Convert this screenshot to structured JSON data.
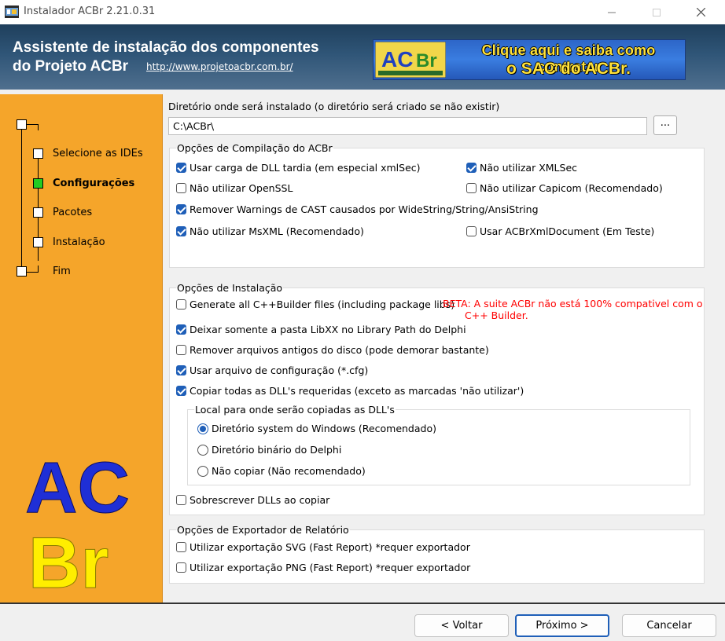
{
  "window": {
    "title": "Instalador ACBr 2.21.0.31"
  },
  "header": {
    "title_line1": "Assistente de instalação dos componentes",
    "title_line2": "do Projeto ACBr",
    "link": "http://www.projetoacbr.com.br/",
    "banner_line1": "Clique aqui e saiba como contratar",
    "banner_line2": "o SAC do ACBr.",
    "banner_logo_text": "ACBr",
    "banner_logo_sub": "Automação Comercial Brasil"
  },
  "sidebar": {
    "steps": [
      {
        "label": "Selecione as IDEs",
        "active": false
      },
      {
        "label": "Configurações",
        "active": true
      },
      {
        "label": "Pacotes",
        "active": false
      },
      {
        "label": "Instalação",
        "active": false
      },
      {
        "label": "Fim",
        "active": false
      }
    ],
    "logo_top": "AC",
    "logo_bottom": "Br"
  },
  "main": {
    "dir_label": "Diretório onde será instalado (o diretório será criado se não existir)",
    "dir_value": "C:\\ACBr\\",
    "browse_label": "...",
    "compile_group": {
      "title": "Opções de Compilação do ACBr",
      "options": [
        {
          "label": "Usar carga de DLL tardia (em especial xmlSec)",
          "checked": true
        },
        {
          "label": "Não utilizar XMLSec",
          "checked": true
        },
        {
          "label": "Não utilizar OpenSSL",
          "checked": false
        },
        {
          "label": "Não utilizar Capicom (Recomendado)",
          "checked": false
        },
        {
          "label": "Remover Warnings de CAST causados por WideString/String/AnsiString",
          "checked": true
        },
        {
          "label": "Não utilizar MsXML (Recomendado)",
          "checked": true
        },
        {
          "label": "Usar ACBrXmlDocument (Em Teste)",
          "checked": false
        }
      ]
    },
    "install_group": {
      "title": "Opções de Instalação",
      "options": [
        {
          "label": "Generate all C++Builder files (including package libs)",
          "checked": false
        },
        {
          "label": "Deixar somente a pasta LibXX no Library Path do Delphi",
          "checked": true
        },
        {
          "label": "Remover arquivos antigos do disco (pode demorar bastante)",
          "checked": false
        },
        {
          "label": "Usar arquivo de configuração (*.cfg)",
          "checked": true
        },
        {
          "label": "Copiar todas as DLL's requeridas (exceto as marcadas 'não utilizar')",
          "checked": true
        },
        {
          "label": "Sobrescrever DLLs ao copiar",
          "checked": false
        }
      ],
      "beta_line1": "BETA: A suite ACBr não está 100% compativel com o",
      "beta_line2": "C++ Builder.",
      "dll_group": {
        "title": "Local para onde serão copiadas as DLL's",
        "options": [
          {
            "label": "Diretório system do Windows (Recomendado)",
            "selected": true
          },
          {
            "label": "Diretório binário do Delphi",
            "selected": false
          },
          {
            "label": "Não copiar (Não recomendado)",
            "selected": false
          }
        ]
      }
    },
    "export_group": {
      "title": "Opções de Exportador de Relatório",
      "options": [
        {
          "label": "Utilizar exportação SVG (Fast Report) *requer exportador",
          "checked": false
        },
        {
          "label": "Utilizar exportação PNG (Fast Report) *requer exportador",
          "checked": false
        }
      ]
    }
  },
  "footer": {
    "back_label": "< Voltar",
    "next_label": "Próximo >",
    "cancel_label": "Cancelar"
  },
  "colors": {
    "sidebar": "#f5a52a",
    "accent": "#1f5fb8",
    "beta": "#ff0000",
    "logo_blue": "#1f2fd6",
    "logo_yellow": "#ffee00"
  }
}
